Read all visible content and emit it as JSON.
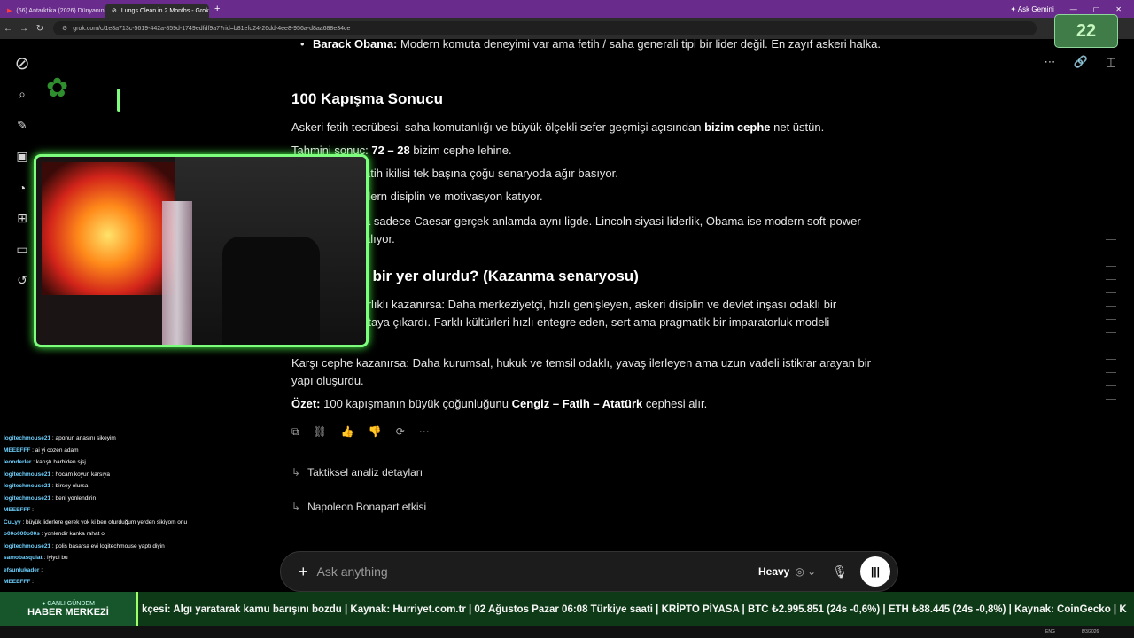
{
  "browser": {
    "tabs": [
      {
        "label": "(66) Antarktika (2026) Dünyanın",
        "active": false
      },
      {
        "label": "Lungs Clean in 2 Months - Grok",
        "active": true
      }
    ],
    "new_tab": "+",
    "ask_gemini": "Ask Gemini",
    "url": "grok.com/c/1e8a713c-5619-442a-859d-1749edfdf9a7?rid=b81efd24-26dd-4ee8-956a-d8aa688e34ce"
  },
  "overlay": {
    "counter": "22"
  },
  "sidebar": {
    "icons": [
      "grok-logo-icon",
      "search-icon",
      "edit-icon",
      "image-icon",
      "history-icon",
      "apps-icon",
      "folder-icon",
      "history-clock-icon"
    ]
  },
  "response": {
    "obama_bullet_bold": "Barack Obama:",
    "obama_bullet_text": "Modern komuta deneyimi var ama fetih / saha generali tipi bir lider değil. En zayıf askeri halka.",
    "h1": "100 Kapışma Sonucu",
    "p1_pre": "Askeri fetih tecrübesi, saha komutanlığı ve büyük ölçekli sefer geçmişi açısından",
    "p1_bold": "bizim cephe",
    "p1_post": "net üstün.",
    "p2_pre": "Tahmini sonuç:",
    "p2_bold": "72 – 28",
    "p2_post": "bizim cephe lehine.",
    "p3": "atih ikilisi tek başına çoğu senaryoda ağır basıyor.",
    "p4": "dern disiplin ve motivasyon katıyor.",
    "p5_line1": "a sadece Caesar gerçek anlamda aynı ligde. Lincoln siyasi liderlik, Obama ise modern soft-power",
    "p5_line2": "alıyor.",
    "h2": "l bir yer olurdu? (Kazanma senaryosu)",
    "p6_line1": "ırlıklı kazanırsa: Daha merkeziyetçi, hızlı genişleyen, askeri disiplin ve devlet inşası odaklı bir",
    "p6_line2": "rtaya çıkardı. Farklı kültürleri hızlı entegre eden, sert ama pragmatik bir imparatorluk modeli",
    "p7_line1": "Karşı cephe kazanırsa: Daha kurumsal, hukuk ve temsil odaklı, yavaş ilerleyen ama uzun vadeli istikrar arayan bir",
    "p7_line2": "yapı oluşurdu.",
    "summary_label": "Özet:",
    "summary_pre": "100 kapışmanın büyük çoğunluğunu",
    "summary_bold": "Cengiz – Fatih – Atatürk",
    "summary_post": "cephesi alır."
  },
  "followups": [
    "Taktiksel analiz detayları",
    "Napoleon Bonapart etkisi"
  ],
  "composer": {
    "placeholder": "Ask anything",
    "mode": "Heavy"
  },
  "chat": [
    {
      "user": "logitechmouse21",
      "msg": ": aponun anasını sikeyim"
    },
    {
      "user": "MEEEFFF",
      "msg": ": ai yi cozen adam"
    },
    {
      "user": "leonderler",
      "msg": ": karıştı harbiden sjsj"
    },
    {
      "user": "logitechmouse21",
      "msg": ": hocam koyun karsıya"
    },
    {
      "user": "logitechmouse21",
      "msg": ": birsey olursa"
    },
    {
      "user": "logitechmouse21",
      "msg": ": beni yonlendirin"
    },
    {
      "user": "MEEEFFF",
      "msg": ":"
    },
    {
      "user": "CuLyy",
      "msg": ": büyük liderlere gerek yok ki ben oturduğum yerden sikiyom onu"
    },
    {
      "user": "o00o000o00s",
      "msg": ": yonlendir kanka rahat ol"
    },
    {
      "user": "logitechmouse21",
      "msg": ": polis basarsa evi logitechmouse yaptı diyin"
    },
    {
      "user": "samobasqulat",
      "msg": ": iyiydi bu"
    },
    {
      "user": "efsunlukader",
      "msg": ":"
    },
    {
      "user": "MEEEFFF",
      "msg": ":"
    }
  ],
  "ticker": {
    "label_top": "● CANLI GÜNDEM",
    "label_main": "HABER MERKEZİ",
    "text": "kçesi: Algı yaratarak kamu barışını bozdu | Kaynak: Hurriyet.com.tr | 02 Ağustos Pazar 06:08 Türkiye saati | KRİPTO PİYASA | BTC ₺2.995.851 (24s -0,6%) | ETH ₺88.445 (24s -0,8%) | Kaynak: CoinGecko | K"
  },
  "taskbar": {
    "lang": "ENG",
    "date": "8/3/2026"
  }
}
